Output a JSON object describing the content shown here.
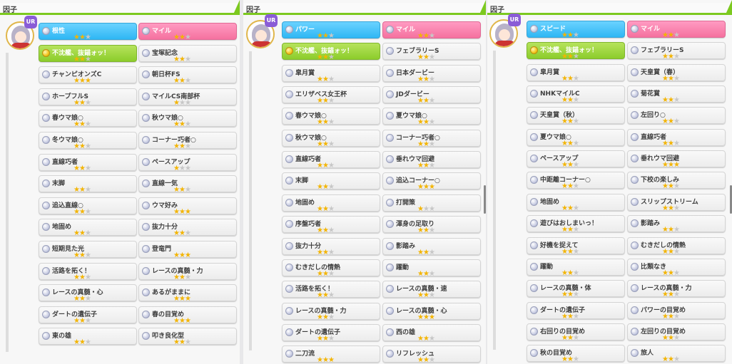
{
  "panels": [
    {
      "title": "因子",
      "badge": "UR",
      "items": [
        {
          "label": "根性",
          "stars": 2,
          "style": "blue"
        },
        {
          "label": "マイル",
          "stars": 2,
          "style": "pink"
        },
        {
          "label": "不沈艦、抜錨ォッ！",
          "stars": 2,
          "style": "green"
        },
        {
          "label": "宝塚記念",
          "stars": 2,
          "style": "white"
        },
        {
          "label": "チャンピオンズC",
          "stars": 3,
          "style": "white"
        },
        {
          "label": "朝日杯FS",
          "stars": 2,
          "style": "white"
        },
        {
          "label": "ホープフルS",
          "stars": 2,
          "style": "white"
        },
        {
          "label": "マイルCS南部杯",
          "stars": 1,
          "style": "white"
        },
        {
          "label": "春ウマ娘○",
          "stars": 2,
          "style": "white"
        },
        {
          "label": "秋ウマ娘○",
          "stars": 2,
          "style": "white"
        },
        {
          "label": "冬ウマ娘○",
          "stars": 2,
          "style": "white"
        },
        {
          "label": "コーナー巧者○",
          "stars": 2,
          "style": "white"
        },
        {
          "label": "直線巧者",
          "stars": 2,
          "style": "white"
        },
        {
          "label": "ペースアップ",
          "stars": 1,
          "style": "white"
        },
        {
          "label": "末脚",
          "stars": 2,
          "style": "white"
        },
        {
          "label": "直線一気",
          "stars": 2,
          "style": "white"
        },
        {
          "label": "追込直線○",
          "stars": 2,
          "style": "white"
        },
        {
          "label": "ウマ好み",
          "stars": 3,
          "style": "white"
        },
        {
          "label": "地固め",
          "stars": 2,
          "style": "white"
        },
        {
          "label": "抜力十分",
          "stars": 2,
          "style": "white"
        },
        {
          "label": "短期見た光",
          "stars": 2,
          "style": "white"
        },
        {
          "label": "登竜門",
          "stars": 3,
          "style": "white"
        },
        {
          "label": "活路を拓く！",
          "stars": 2,
          "style": "white"
        },
        {
          "label": "レースの真髄・力",
          "stars": 2,
          "style": "white"
        },
        {
          "label": "レースの真髄・心",
          "stars": 2,
          "style": "white"
        },
        {
          "label": "あるがままに",
          "stars": 3,
          "style": "white"
        },
        {
          "label": "ダートの遺伝子",
          "stars": 2,
          "style": "white"
        },
        {
          "label": "春の目覚め",
          "stars": 3,
          "style": "white"
        },
        {
          "label": "東の雄",
          "stars": 2,
          "style": "white"
        },
        {
          "label": "叩き良化型",
          "stars": 2,
          "style": "white"
        }
      ]
    },
    {
      "title": "因子",
      "badge": "UR",
      "items": [
        {
          "label": "パワー",
          "stars": 2,
          "style": "blue"
        },
        {
          "label": "マイル",
          "stars": 2,
          "style": "pink"
        },
        {
          "label": "不沈艦、抜錨ォッ！",
          "stars": 2,
          "style": "green"
        },
        {
          "label": "フェブラリーS",
          "stars": 2,
          "style": "white"
        },
        {
          "label": "皐月賞",
          "stars": 2,
          "style": "white"
        },
        {
          "label": "日本ダービー",
          "stars": 2,
          "style": "white"
        },
        {
          "label": "エリザベス女王杯",
          "stars": 2,
          "style": "white"
        },
        {
          "label": "JDダービー",
          "stars": 2,
          "style": "white"
        },
        {
          "label": "春ウマ娘○",
          "stars": 2,
          "style": "white"
        },
        {
          "label": "夏ウマ娘○",
          "stars": 2,
          "style": "white"
        },
        {
          "label": "秋ウマ娘○",
          "stars": 2,
          "style": "white"
        },
        {
          "label": "コーナー巧者○",
          "stars": 2,
          "style": "white"
        },
        {
          "label": "直線巧者",
          "stars": 2,
          "style": "white"
        },
        {
          "label": "垂れウマ回避",
          "stars": 2,
          "style": "white"
        },
        {
          "label": "末脚",
          "stars": 2,
          "style": "white"
        },
        {
          "label": "追込コーナー○",
          "stars": 3,
          "style": "white"
        },
        {
          "label": "地固め",
          "stars": 2,
          "style": "white"
        },
        {
          "label": "打開策",
          "stars": 1,
          "style": "white"
        },
        {
          "label": "序盤巧者",
          "stars": 2,
          "style": "white"
        },
        {
          "label": "渾身の足取り",
          "stars": 2,
          "style": "white"
        },
        {
          "label": "抜力十分",
          "stars": 2,
          "style": "white"
        },
        {
          "label": "影踏み",
          "stars": 2,
          "style": "white"
        },
        {
          "label": "むきだしの情熱",
          "stars": 2,
          "style": "white"
        },
        {
          "label": "躍動",
          "stars": 2,
          "style": "white"
        },
        {
          "label": "活路を拓く！",
          "stars": 2,
          "style": "white"
        },
        {
          "label": "レースの真髄・速",
          "stars": 2,
          "style": "white"
        },
        {
          "label": "レースの真髄・力",
          "stars": 2,
          "style": "white"
        },
        {
          "label": "レースの真髄・心",
          "stars": 3,
          "style": "white"
        },
        {
          "label": "ダートの遺伝子",
          "stars": 2,
          "style": "white"
        },
        {
          "label": "西の雄",
          "stars": 2,
          "style": "white"
        },
        {
          "label": "二刀流",
          "stars": 3,
          "style": "white"
        },
        {
          "label": "リフレッシュ",
          "stars": 2,
          "style": "white"
        }
      ]
    },
    {
      "title": "因子",
      "badge": "UR",
      "items": [
        {
          "label": "スピード",
          "stars": 2,
          "style": "blue"
        },
        {
          "label": "マイル",
          "stars": 2,
          "style": "pink"
        },
        {
          "label": "不沈艦、抜錨ォッ！",
          "stars": 2,
          "style": "green"
        },
        {
          "label": "フェブラリーS",
          "stars": 2,
          "style": "white"
        },
        {
          "label": "皐月賞",
          "stars": 2,
          "style": "white"
        },
        {
          "label": "天皇賞（春）",
          "stars": 2,
          "style": "white"
        },
        {
          "label": "NHKマイルC",
          "stars": 2,
          "style": "white"
        },
        {
          "label": "菊花賞",
          "stars": 2,
          "style": "white"
        },
        {
          "label": "天皇賞（秋）",
          "stars": 2,
          "style": "white"
        },
        {
          "label": "左回り○",
          "stars": 2,
          "style": "white"
        },
        {
          "label": "夏ウマ娘○",
          "stars": 2,
          "style": "white"
        },
        {
          "label": "直線巧者",
          "stars": 2,
          "style": "white"
        },
        {
          "label": "ペースアップ",
          "stars": 2,
          "style": "white"
        },
        {
          "label": "垂れウマ回避",
          "stars": 3,
          "style": "white"
        },
        {
          "label": "中距離コーナー○",
          "stars": 2,
          "style": "white"
        },
        {
          "label": "下校の楽しみ",
          "stars": 2,
          "style": "white"
        },
        {
          "label": "地固め",
          "stars": 2,
          "style": "white"
        },
        {
          "label": "スリップストリーム",
          "stars": 2,
          "style": "white"
        },
        {
          "label": "遊びはおしまいっ！",
          "stars": 2,
          "style": "white"
        },
        {
          "label": "影踏み",
          "stars": 2,
          "style": "white"
        },
        {
          "label": "好機を捉えて",
          "stars": 2,
          "style": "white"
        },
        {
          "label": "むきだしの情熱",
          "stars": 2,
          "style": "white"
        },
        {
          "label": "躍動",
          "stars": 2,
          "style": "white"
        },
        {
          "label": "比類なき",
          "stars": 2,
          "style": "white"
        },
        {
          "label": "レースの真髄・体",
          "stars": 2,
          "style": "white"
        },
        {
          "label": "レースの真髄・力",
          "stars": 2,
          "style": "white"
        },
        {
          "label": "ダートの遺伝子",
          "stars": 2,
          "style": "white"
        },
        {
          "label": "パワーの目覚め",
          "stars": 2,
          "style": "white"
        },
        {
          "label": "右回りの目覚め",
          "stars": 2,
          "style": "white"
        },
        {
          "label": "左回りの目覚め",
          "stars": 2,
          "style": "white"
        },
        {
          "label": "秋の目覚め",
          "stars": 2,
          "style": "white"
        },
        {
          "label": "旅人",
          "stars": 2,
          "style": "white"
        }
      ]
    }
  ]
}
